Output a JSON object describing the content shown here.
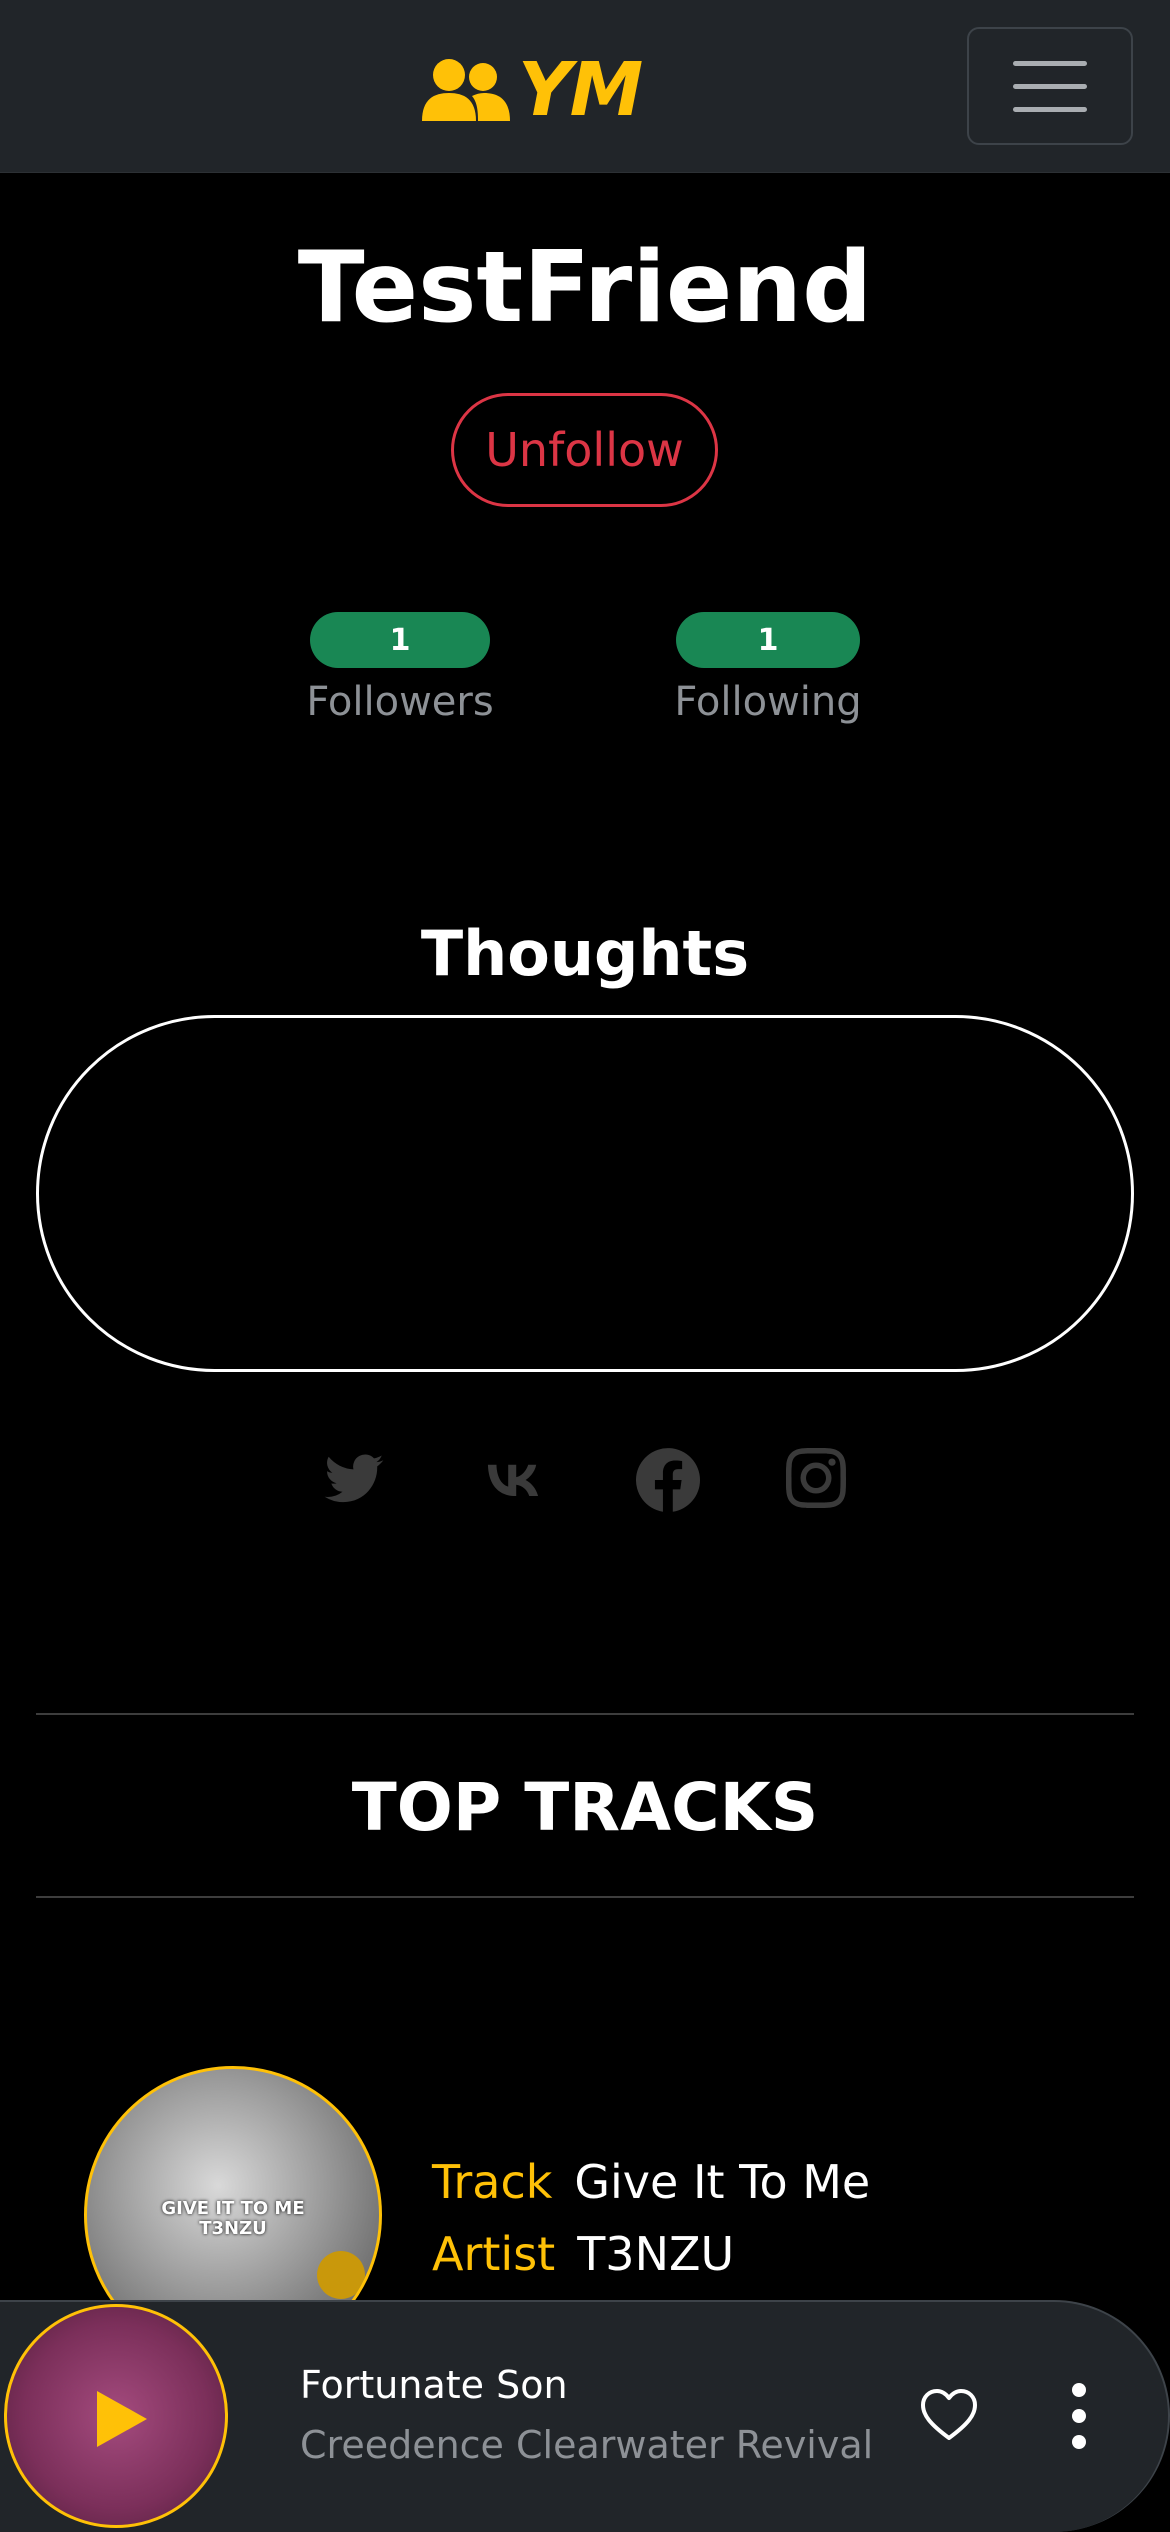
{
  "navbar": {
    "brand": "YM",
    "brand_color": "#ffc107",
    "brand_icon": "users-icon",
    "menu_icon": "hamburger-menu-icon"
  },
  "profile": {
    "username": "TestFriend",
    "unfollow_label": "Unfollow",
    "followers_count": "1",
    "followers_label": "Followers",
    "following_count": "1",
    "following_label": "Following"
  },
  "thoughts": {
    "title": "Thoughts",
    "text": ""
  },
  "socials": [
    "twitter-icon",
    "vk-icon",
    "facebook-icon",
    "instagram-icon"
  ],
  "top_tracks": {
    "title": "TOP TRACKS",
    "items": [
      {
        "track_key": "Track",
        "track": "Give It To Me",
        "artist_key": "Artist",
        "artist": "T3NZU",
        "cover_text": "GIVE IT TO ME",
        "cover_artist": "T3NZU"
      }
    ]
  },
  "player": {
    "title": "Fortunate Son",
    "artist": "Creedence Clearwater Revival",
    "like_icon": "heart-icon",
    "more_icon": "more-vertical-icon",
    "play_icon": "play-icon"
  },
  "colors": {
    "accent": "#ffc107",
    "danger": "#dc3545",
    "success": "#198754",
    "navbar_bg": "#212529"
  }
}
